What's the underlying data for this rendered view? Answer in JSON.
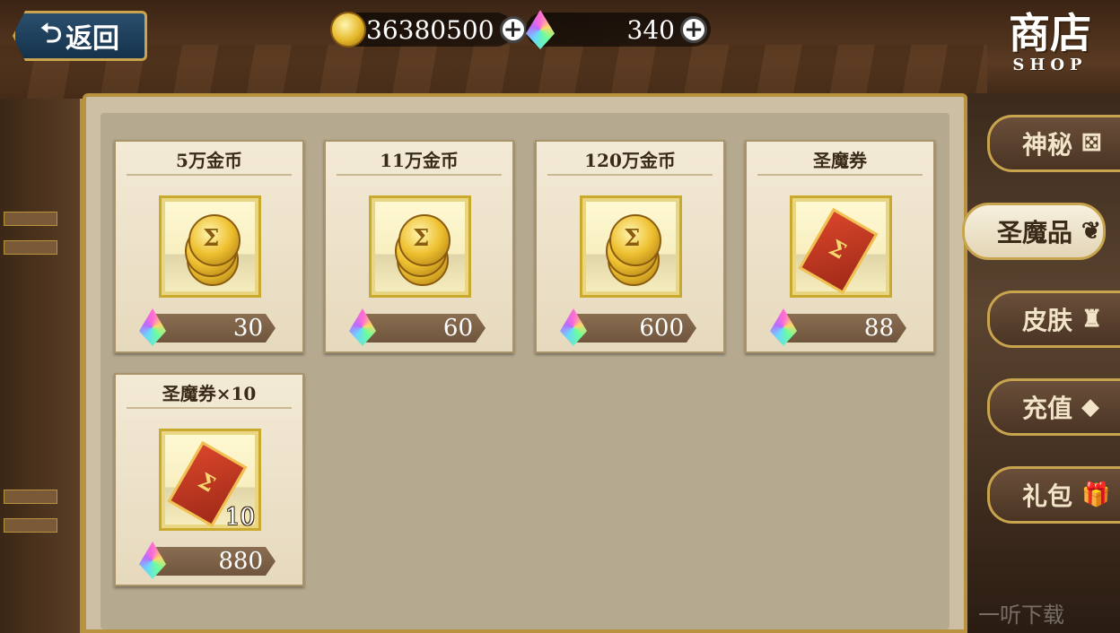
{
  "header": {
    "back_label": "返回",
    "gold_amount": "36380500",
    "gem_amount": "340",
    "shop_title": "商店",
    "shop_title_en": "SHOP"
  },
  "items": [
    {
      "title": "5万金币",
      "icon": "gold-coins-icon",
      "price": "30"
    },
    {
      "title": "11万金币",
      "icon": "gold-coins-icon",
      "price": "60"
    },
    {
      "title": "120万金币",
      "icon": "gold-coins-icon",
      "price": "600"
    },
    {
      "title": "圣魔券",
      "icon": "holy-demon-ticket-icon",
      "price": "88"
    },
    {
      "title": "圣魔券×10",
      "icon": "holy-demon-ticket-icon",
      "price": "880",
      "qty": "10"
    }
  ],
  "tabs": [
    {
      "label": "神秘",
      "icon": "dice-icon"
    },
    {
      "label": "圣魔品",
      "icon": "leaf-icon",
      "active": true
    },
    {
      "label": "皮肤",
      "icon": "shirt-icon"
    },
    {
      "label": "充值",
      "icon": "gem-icon"
    },
    {
      "label": "礼包",
      "icon": "gift-icon"
    }
  ],
  "watermark": "一听下载",
  "colors": {
    "gold": "#c9a44e",
    "panel": "#b5a98f",
    "card": "#f3ead6"
  }
}
